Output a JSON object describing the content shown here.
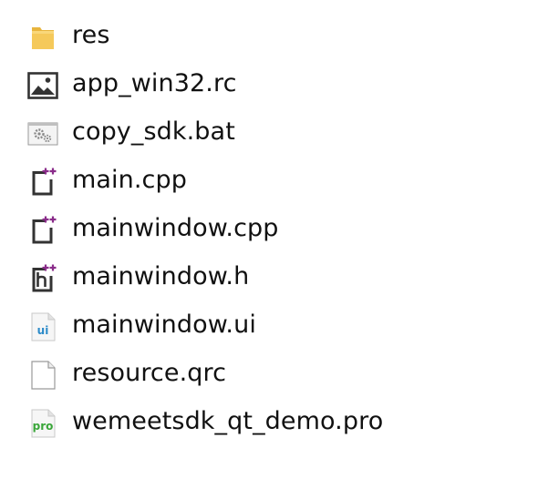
{
  "files": [
    {
      "name": "res",
      "icon": "folder-icon"
    },
    {
      "name": "app_win32.rc",
      "icon": "image-file-icon"
    },
    {
      "name": "copy_sdk.bat",
      "icon": "batch-file-icon"
    },
    {
      "name": "main.cpp",
      "icon": "cpp-file-icon"
    },
    {
      "name": "mainwindow.cpp",
      "icon": "cpp-file-icon"
    },
    {
      "name": "mainwindow.h",
      "icon": "header-file-icon"
    },
    {
      "name": "mainwindow.ui",
      "icon": "qt-ui-file-icon"
    },
    {
      "name": "resource.qrc",
      "icon": "blank-file-icon"
    },
    {
      "name": "wemeetsdk_qt_demo.pro",
      "icon": "qt-pro-file-icon"
    }
  ],
  "colors": {
    "folder": "#f2c04a",
    "qt_purple": "#8a2c8a",
    "qt_ui_blue": "#2d8bc9",
    "qt_pro_green": "#3aa63a",
    "text": "#111111"
  }
}
